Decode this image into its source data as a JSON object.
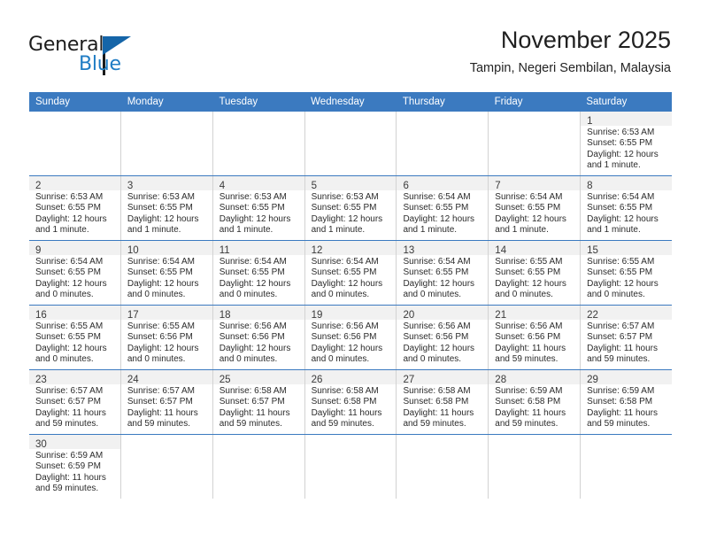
{
  "brand": {
    "name_top": "General",
    "name_bottom": "Blue",
    "accent_color": "#1f7cc4",
    "flag_color": "#1565a8"
  },
  "header": {
    "title": "November 2025",
    "subtitle": "Tampin, Negeri Sembilan, Malaysia"
  },
  "theme": {
    "header_blue": "#3b7ac0",
    "daynum_strip": "#f1f1f1",
    "cell_border": "#d2d2d2"
  },
  "weekdays": [
    "Sunday",
    "Monday",
    "Tuesday",
    "Wednesday",
    "Thursday",
    "Friday",
    "Saturday"
  ],
  "weeks": [
    [
      {
        "day": "",
        "blank": true
      },
      {
        "day": "",
        "blank": true
      },
      {
        "day": "",
        "blank": true
      },
      {
        "day": "",
        "blank": true
      },
      {
        "day": "",
        "blank": true
      },
      {
        "day": "",
        "blank": true
      },
      {
        "day": "1",
        "sunrise": "Sunrise: 6:53 AM",
        "sunset": "Sunset: 6:55 PM",
        "daylight": "Daylight: 12 hours and 1 minute."
      }
    ],
    [
      {
        "day": "2",
        "sunrise": "Sunrise: 6:53 AM",
        "sunset": "Sunset: 6:55 PM",
        "daylight": "Daylight: 12 hours and 1 minute."
      },
      {
        "day": "3",
        "sunrise": "Sunrise: 6:53 AM",
        "sunset": "Sunset: 6:55 PM",
        "daylight": "Daylight: 12 hours and 1 minute."
      },
      {
        "day": "4",
        "sunrise": "Sunrise: 6:53 AM",
        "sunset": "Sunset: 6:55 PM",
        "daylight": "Daylight: 12 hours and 1 minute."
      },
      {
        "day": "5",
        "sunrise": "Sunrise: 6:53 AM",
        "sunset": "Sunset: 6:55 PM",
        "daylight": "Daylight: 12 hours and 1 minute."
      },
      {
        "day": "6",
        "sunrise": "Sunrise: 6:54 AM",
        "sunset": "Sunset: 6:55 PM",
        "daylight": "Daylight: 12 hours and 1 minute."
      },
      {
        "day": "7",
        "sunrise": "Sunrise: 6:54 AM",
        "sunset": "Sunset: 6:55 PM",
        "daylight": "Daylight: 12 hours and 1 minute."
      },
      {
        "day": "8",
        "sunrise": "Sunrise: 6:54 AM",
        "sunset": "Sunset: 6:55 PM",
        "daylight": "Daylight: 12 hours and 1 minute."
      }
    ],
    [
      {
        "day": "9",
        "sunrise": "Sunrise: 6:54 AM",
        "sunset": "Sunset: 6:55 PM",
        "daylight": "Daylight: 12 hours and 0 minutes."
      },
      {
        "day": "10",
        "sunrise": "Sunrise: 6:54 AM",
        "sunset": "Sunset: 6:55 PM",
        "daylight": "Daylight: 12 hours and 0 minutes."
      },
      {
        "day": "11",
        "sunrise": "Sunrise: 6:54 AM",
        "sunset": "Sunset: 6:55 PM",
        "daylight": "Daylight: 12 hours and 0 minutes."
      },
      {
        "day": "12",
        "sunrise": "Sunrise: 6:54 AM",
        "sunset": "Sunset: 6:55 PM",
        "daylight": "Daylight: 12 hours and 0 minutes."
      },
      {
        "day": "13",
        "sunrise": "Sunrise: 6:54 AM",
        "sunset": "Sunset: 6:55 PM",
        "daylight": "Daylight: 12 hours and 0 minutes."
      },
      {
        "day": "14",
        "sunrise": "Sunrise: 6:55 AM",
        "sunset": "Sunset: 6:55 PM",
        "daylight": "Daylight: 12 hours and 0 minutes."
      },
      {
        "day": "15",
        "sunrise": "Sunrise: 6:55 AM",
        "sunset": "Sunset: 6:55 PM",
        "daylight": "Daylight: 12 hours and 0 minutes."
      }
    ],
    [
      {
        "day": "16",
        "sunrise": "Sunrise: 6:55 AM",
        "sunset": "Sunset: 6:55 PM",
        "daylight": "Daylight: 12 hours and 0 minutes."
      },
      {
        "day": "17",
        "sunrise": "Sunrise: 6:55 AM",
        "sunset": "Sunset: 6:56 PM",
        "daylight": "Daylight: 12 hours and 0 minutes."
      },
      {
        "day": "18",
        "sunrise": "Sunrise: 6:56 AM",
        "sunset": "Sunset: 6:56 PM",
        "daylight": "Daylight: 12 hours and 0 minutes."
      },
      {
        "day": "19",
        "sunrise": "Sunrise: 6:56 AM",
        "sunset": "Sunset: 6:56 PM",
        "daylight": "Daylight: 12 hours and 0 minutes."
      },
      {
        "day": "20",
        "sunrise": "Sunrise: 6:56 AM",
        "sunset": "Sunset: 6:56 PM",
        "daylight": "Daylight: 12 hours and 0 minutes."
      },
      {
        "day": "21",
        "sunrise": "Sunrise: 6:56 AM",
        "sunset": "Sunset: 6:56 PM",
        "daylight": "Daylight: 11 hours and 59 minutes."
      },
      {
        "day": "22",
        "sunrise": "Sunrise: 6:57 AM",
        "sunset": "Sunset: 6:57 PM",
        "daylight": "Daylight: 11 hours and 59 minutes."
      }
    ],
    [
      {
        "day": "23",
        "sunrise": "Sunrise: 6:57 AM",
        "sunset": "Sunset: 6:57 PM",
        "daylight": "Daylight: 11 hours and 59 minutes."
      },
      {
        "day": "24",
        "sunrise": "Sunrise: 6:57 AM",
        "sunset": "Sunset: 6:57 PM",
        "daylight": "Daylight: 11 hours and 59 minutes."
      },
      {
        "day": "25",
        "sunrise": "Sunrise: 6:58 AM",
        "sunset": "Sunset: 6:57 PM",
        "daylight": "Daylight: 11 hours and 59 minutes."
      },
      {
        "day": "26",
        "sunrise": "Sunrise: 6:58 AM",
        "sunset": "Sunset: 6:58 PM",
        "daylight": "Daylight: 11 hours and 59 minutes."
      },
      {
        "day": "27",
        "sunrise": "Sunrise: 6:58 AM",
        "sunset": "Sunset: 6:58 PM",
        "daylight": "Daylight: 11 hours and 59 minutes."
      },
      {
        "day": "28",
        "sunrise": "Sunrise: 6:59 AM",
        "sunset": "Sunset: 6:58 PM",
        "daylight": "Daylight: 11 hours and 59 minutes."
      },
      {
        "day": "29",
        "sunrise": "Sunrise: 6:59 AM",
        "sunset": "Sunset: 6:58 PM",
        "daylight": "Daylight: 11 hours and 59 minutes."
      }
    ],
    [
      {
        "day": "30",
        "sunrise": "Sunrise: 6:59 AM",
        "sunset": "Sunset: 6:59 PM",
        "daylight": "Daylight: 11 hours and 59 minutes."
      },
      {
        "day": "",
        "blank": true
      },
      {
        "day": "",
        "blank": true
      },
      {
        "day": "",
        "blank": true
      },
      {
        "day": "",
        "blank": true
      },
      {
        "day": "",
        "blank": true
      },
      {
        "day": "",
        "blank": true
      }
    ]
  ]
}
